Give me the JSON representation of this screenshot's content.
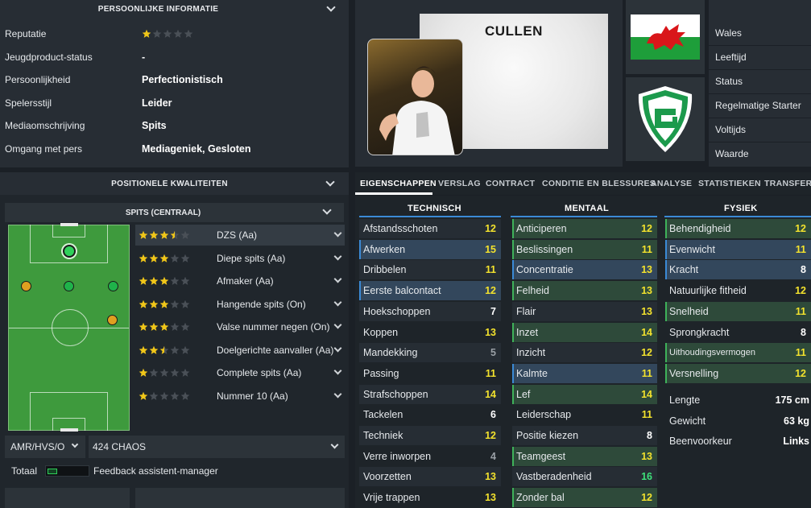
{
  "personal_info": {
    "title": "PERSOONLIJKE INFORMATIE",
    "rows": [
      {
        "label": "Reputatie",
        "value": "",
        "stars": 1
      },
      {
        "label": "Jeugdproduct-status",
        "value": "-"
      },
      {
        "label": "Persoonlijkheid",
        "value": "Perfectionistisch"
      },
      {
        "label": "Spelersstijl",
        "value": "Leider"
      },
      {
        "label": "Mediaomschrijving",
        "value": "Spits"
      },
      {
        "label": "Omgang met pers",
        "value": "Mediageniek, Gesloten"
      }
    ]
  },
  "positional": {
    "title": "POSITIONELE KWALITEITEN",
    "position_header": "SPITS (CENTRAAL)",
    "roles": [
      {
        "name": "DZS (Aa)",
        "stars": 3.5
      },
      {
        "name": "Diepe spits (Aa)",
        "stars": 3
      },
      {
        "name": "Afmaker (Aa)",
        "stars": 3
      },
      {
        "name": "Hangende spits (On)",
        "stars": 3
      },
      {
        "name": "Valse nummer negen (On)",
        "stars": 3
      },
      {
        "name": "Doelgerichte aanvaller (Aa)",
        "stars": 2.5
      },
      {
        "name": "Complete spits (Aa)",
        "stars": 1
      },
      {
        "name": "Nummer 10 (Aa)",
        "stars": 1
      }
    ],
    "position_select": "AMR/HVS/O",
    "chaos_select": "424 CHAOS",
    "total_label": "Totaal",
    "feedback_label": "Feedback assistent-manager"
  },
  "player": {
    "name": "CULLEN",
    "nation_flag": "wales-flag",
    "club_badge": "fc-groningen-badge"
  },
  "info_labels": [
    "Wales",
    "Leeftijd",
    "Status",
    "Regelmatige Starter",
    "Voltijds",
    "Waarde"
  ],
  "tabs": [
    "EIGENSCHAPPEN",
    "VERSLAG",
    "CONTRACT",
    "CONDITIE EN BLESSURES",
    "ANALYSE",
    "STATISTIEKEN",
    "TRANSFERS"
  ],
  "attributes": {
    "technical": {
      "title": "TECHNISCH",
      "items": [
        {
          "name": "Afstandsschoten",
          "value": "12",
          "color": "y"
        },
        {
          "name": "Afwerken",
          "value": "15",
          "color": "y",
          "hl": "blue"
        },
        {
          "name": "Dribbelen",
          "value": "11",
          "color": "y"
        },
        {
          "name": "Eerste balcontact",
          "value": "12",
          "color": "y",
          "hl": "blue"
        },
        {
          "name": "Hoekschoppen",
          "value": "7",
          "color": "w"
        },
        {
          "name": "Koppen",
          "value": "13",
          "color": "y"
        },
        {
          "name": "Mandekking",
          "value": "5",
          "color": "g"
        },
        {
          "name": "Passing",
          "value": "11",
          "color": "y"
        },
        {
          "name": "Strafschoppen",
          "value": "14",
          "color": "y"
        },
        {
          "name": "Tackelen",
          "value": "6",
          "color": "w"
        },
        {
          "name": "Techniek",
          "value": "12",
          "color": "y"
        },
        {
          "name": "Verre inworpen",
          "value": "4",
          "color": "g"
        },
        {
          "name": "Voorzetten",
          "value": "13",
          "color": "y"
        },
        {
          "name": "Vrije trappen",
          "value": "13",
          "color": "y"
        }
      ]
    },
    "mental": {
      "title": "MENTAAL",
      "items": [
        {
          "name": "Anticiperen",
          "value": "12",
          "color": "y",
          "hl": "green"
        },
        {
          "name": "Beslissingen",
          "value": "11",
          "color": "y",
          "hl": "green"
        },
        {
          "name": "Concentratie",
          "value": "13",
          "color": "y",
          "hl": "blue"
        },
        {
          "name": "Felheid",
          "value": "13",
          "color": "y",
          "hl": "green"
        },
        {
          "name": "Flair",
          "value": "13",
          "color": "y"
        },
        {
          "name": "Inzet",
          "value": "14",
          "color": "y",
          "hl": "green"
        },
        {
          "name": "Inzicht",
          "value": "12",
          "color": "y"
        },
        {
          "name": "Kalmte",
          "value": "11",
          "color": "y",
          "hl": "blue"
        },
        {
          "name": "Lef",
          "value": "14",
          "color": "y",
          "hl": "green"
        },
        {
          "name": "Leiderschap",
          "value": "11",
          "color": "y"
        },
        {
          "name": "Positie kiezen",
          "value": "8",
          "color": "w"
        },
        {
          "name": "Teamgeest",
          "value": "13",
          "color": "y",
          "hl": "green"
        },
        {
          "name": "Vastberadenheid",
          "value": "16",
          "color": "gr"
        },
        {
          "name": "Zonder bal",
          "value": "12",
          "color": "y",
          "hl": "green"
        }
      ]
    },
    "physical": {
      "title": "FYSIEK",
      "items": [
        {
          "name": "Behendigheid",
          "value": "12",
          "color": "y",
          "hl": "green"
        },
        {
          "name": "Evenwicht",
          "value": "11",
          "color": "y",
          "hl": "blue"
        },
        {
          "name": "Kracht",
          "value": "8",
          "color": "w",
          "hl": "blue"
        },
        {
          "name": "Natuurlijke fitheid",
          "value": "12",
          "color": "y"
        },
        {
          "name": "Snelheid",
          "value": "11",
          "color": "y",
          "hl": "green"
        },
        {
          "name": "Sprongkracht",
          "value": "8",
          "color": "w"
        },
        {
          "name": "Uithoudingsvermogen",
          "value": "11",
          "color": "y",
          "hl": "green"
        },
        {
          "name": "Versnelling",
          "value": "12",
          "color": "y",
          "hl": "green"
        }
      ],
      "extra": [
        {
          "name": "Lengte",
          "value": "175 cm"
        },
        {
          "name": "Gewicht",
          "value": "63 kg"
        },
        {
          "name": "Beenvoorkeur",
          "value": "Links"
        }
      ]
    }
  }
}
